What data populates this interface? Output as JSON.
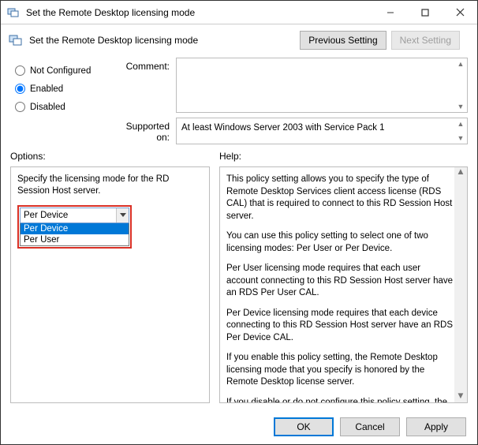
{
  "window": {
    "title": "Set the Remote Desktop licensing mode",
    "subtitle": "Set the Remote Desktop licensing mode",
    "buttons": {
      "previous": "Previous Setting",
      "next": "Next Setting",
      "ok": "OK",
      "cancel": "Cancel",
      "apply": "Apply"
    }
  },
  "radios": {
    "not_configured": "Not Configured",
    "enabled": "Enabled",
    "disabled": "Disabled",
    "selected": "enabled"
  },
  "labels": {
    "comment": "Comment:",
    "supported": "Supported on:",
    "options": "Options:",
    "help": "Help:"
  },
  "supported_text": "At least Windows Server 2003 with Service Pack 1",
  "options": {
    "instruction": "Specify the licensing mode for the RD Session Host server.",
    "combo_value": "Per Device",
    "dropdown": {
      "item0": "Per Device",
      "item1": "Per User"
    }
  },
  "help": {
    "p0": "This policy setting allows you to specify the type of Remote Desktop Services client access license (RDS CAL) that is required to connect to this RD Session Host server.",
    "p1": "You can use this policy setting to select one of two licensing modes: Per User or Per Device.",
    "p2": "Per User licensing mode requires that each user account connecting to this RD Session Host server have an RDS Per User CAL.",
    "p3": "Per Device licensing mode requires that each device connecting to this RD Session Host server have an RDS Per Device CAL.",
    "p4": "If you enable this policy setting, the Remote Desktop licensing mode that you specify is honored by the Remote Desktop license server.",
    "p5": "If you disable or do not configure this policy setting, the licensing mode is not specified at the Group Policy level."
  }
}
